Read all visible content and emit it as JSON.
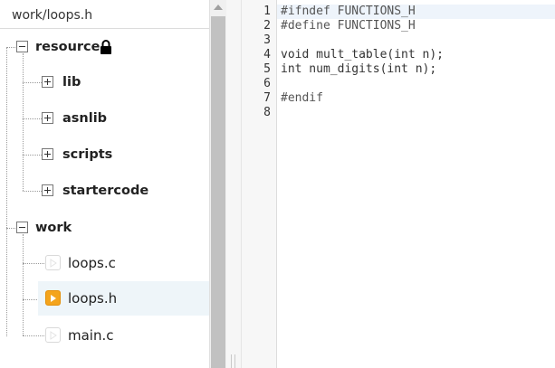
{
  "file_tree": {
    "current_path": "work/loops.h",
    "nodes": [
      {
        "label": "resource",
        "type": "folder",
        "state": "expanded",
        "locked": true
      },
      {
        "label": "lib",
        "type": "folder",
        "state": "collapsed"
      },
      {
        "label": "asnlib",
        "type": "folder",
        "state": "collapsed"
      },
      {
        "label": "scripts",
        "type": "folder",
        "state": "collapsed"
      },
      {
        "label": "startercode",
        "type": "folder",
        "state": "collapsed"
      },
      {
        "label": "work",
        "type": "folder",
        "state": "expanded"
      },
      {
        "label": "loops.c",
        "type": "file"
      },
      {
        "label": "loops.h",
        "type": "file",
        "selected": true
      },
      {
        "label": "main.c",
        "type": "file"
      }
    ],
    "active_file_color": "#f4a41c"
  },
  "editor": {
    "line_numbers": [
      "1",
      "2",
      "3",
      "4",
      "5",
      "6",
      "7",
      "8"
    ],
    "lines": [
      "#ifndef FUNCTIONS_H",
      "#define FUNCTIONS_H",
      "",
      "void mult_table(int n);",
      "int num_digits(int n);",
      "",
      "#endif",
      ""
    ]
  }
}
